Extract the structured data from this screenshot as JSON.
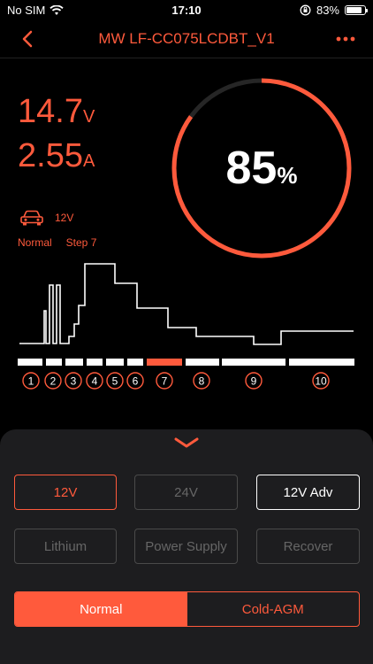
{
  "status": {
    "carrier": "No SIM",
    "time": "17:10",
    "battery": "83%",
    "battery_level": 0.83
  },
  "nav": {
    "title": "MW LF-CC075LCDBT_V1"
  },
  "readings": {
    "voltage": "14.7",
    "voltage_unit": "V",
    "current": "2.55",
    "current_unit": "A"
  },
  "vehicle": {
    "system": "12V"
  },
  "state": {
    "mode": "Normal",
    "step": "Step 7"
  },
  "gauge": {
    "percent": "85",
    "unit": "%",
    "value": 0.85
  },
  "steps": [
    "1",
    "2",
    "3",
    "4",
    "5",
    "6",
    "7",
    "8",
    "9",
    "10"
  ],
  "active_step": 7,
  "colors": {
    "accent": "#ff5a3c",
    "sheet": "#1d1d1f",
    "disabled": "#4a4a4a"
  },
  "options": {
    "v12": "12V",
    "v24": "24V",
    "v12adv": "12V Adv",
    "lithium": "Lithium",
    "power_supply": "Power Supply",
    "recover": "Recover"
  },
  "segment": {
    "normal": "Normal",
    "cold_agm": "Cold-AGM"
  }
}
